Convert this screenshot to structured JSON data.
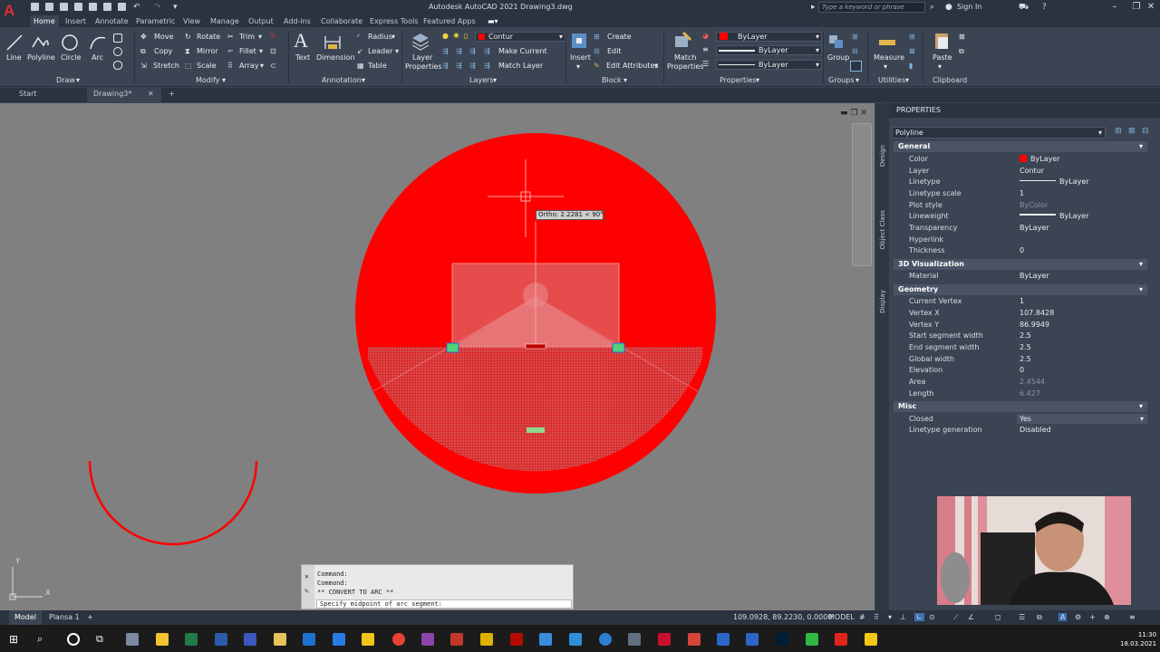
{
  "window": {
    "app_logo": "A",
    "title": "Autodesk AutoCAD 2021    Drawing3.dwg",
    "search_placeholder": "Type a keyword or phrase",
    "sign_in": "Sign In"
  },
  "ribbon_tabs": [
    "Home",
    "Insert",
    "Annotate",
    "Parametric",
    "View",
    "Manage",
    "Output",
    "Add-ins",
    "Collaborate",
    "Express Tools",
    "Featured Apps"
  ],
  "ribbon": {
    "draw": {
      "line": "Line",
      "polyline": "Polyline",
      "circle": "Circle",
      "arc": "Arc",
      "panel": "Draw"
    },
    "modify": {
      "move": "Move",
      "rotate": "Rotate",
      "trim": "Trim",
      "copy": "Copy",
      "mirror": "Mirror",
      "fillet": "Fillet",
      "stretch": "Stretch",
      "scale": "Scale",
      "array": "Array",
      "panel": "Modify"
    },
    "annotation": {
      "text": "Text",
      "dimension": "Dimension",
      "radius": "Radius",
      "leader": "Leader",
      "table": "Table",
      "panel": "Annotation"
    },
    "layers": {
      "layer_properties_1": "Layer",
      "layer_properties_2": "Properties",
      "current_layer": "Contur",
      "make_current": "Make Current",
      "match_layer": "Match Layer",
      "panel": "Layers"
    },
    "block": {
      "insert": "Insert",
      "create": "Create",
      "edit": "Edit",
      "edit_attributes": "Edit Attributes",
      "panel": "Block"
    },
    "properties": {
      "match_1": "Match",
      "match_2": "Properties",
      "color": "ByLayer",
      "lineweight": "ByLayer",
      "linetype": "ByLayer",
      "panel": "Properties"
    },
    "groups": {
      "group": "Group",
      "panel": "Groups"
    },
    "utilities": {
      "measure": "Measure",
      "panel": "Utilities"
    },
    "clipboard": {
      "paste": "Paste",
      "panel": "Clipboard"
    }
  },
  "doc_tabs": {
    "start": "Start",
    "drawing": "Drawing3*"
  },
  "canvas": {
    "tooltip": "Ortho: 2.2281 < 90°",
    "ucs_y": "Y",
    "ucs_x": "X"
  },
  "command": {
    "lines": [
      "Command:",
      "Command:",
      "** CONVERT TO ARC **"
    ],
    "prompt": "Specify midpoint of arc segment:"
  },
  "properties": {
    "title": "PROPERTIES",
    "side_design": "Design",
    "side_object_class": "Object Class",
    "side_display": "Display",
    "object": "Polyline",
    "general": {
      "title": "General",
      "rows": [
        [
          "Color",
          "ByLayer"
        ],
        [
          "Layer",
          "Contur"
        ],
        [
          "Linetype",
          "ByLayer"
        ],
        [
          "Linetype scale",
          "1"
        ],
        [
          "Plot style",
          "ByColor"
        ],
        [
          "Lineweight",
          "ByLayer"
        ],
        [
          "Transparency",
          "ByLayer"
        ],
        [
          "Hyperlink",
          ""
        ],
        [
          "Thickness",
          "0"
        ]
      ]
    },
    "viz": {
      "title": "3D Visualization",
      "rows": [
        [
          "Material",
          "ByLayer"
        ]
      ]
    },
    "geometry": {
      "title": "Geometry",
      "rows": [
        [
          "Current Vertex",
          "1"
        ],
        [
          "Vertex X",
          "107.8428"
        ],
        [
          "Vertex Y",
          "86.9949"
        ],
        [
          "Start segment width",
          "2.5"
        ],
        [
          "End segment width",
          "2.5"
        ],
        [
          "Global width",
          "2.5"
        ],
        [
          "Elevation",
          "0"
        ],
        [
          "Area",
          "2.4544"
        ],
        [
          "Length",
          "6.427"
        ]
      ]
    },
    "misc": {
      "title": "Misc",
      "rows": [
        [
          "Closed",
          "Yes"
        ],
        [
          "Linetype generation",
          "Disabled"
        ]
      ]
    }
  },
  "status": {
    "model_tab": "Model",
    "layout_tab": "Plansa 1",
    "coords": "109.0928, 89.2230, 0.0000",
    "space": "MODEL"
  },
  "taskbar": {
    "time": "11:30",
    "date": "18.03.2021"
  },
  "colors": {
    "accent_red": "#ff0000",
    "canvas_bg": "#808080",
    "ribbon_bg": "#3b4453"
  }
}
